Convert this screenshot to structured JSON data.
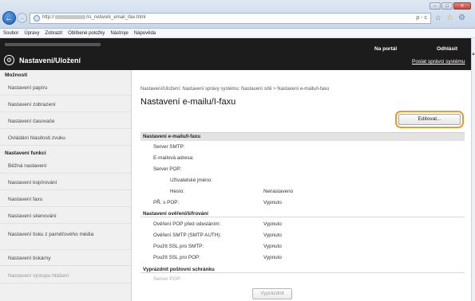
{
  "browser": {
    "url_prefix": "http://",
    "url_suffix": "/rs_network_email_ifax.html",
    "addr_tools": "ρ - c",
    "window_buttons": {
      "min": "–",
      "max": "□",
      "close": "✕"
    }
  },
  "menubar": [
    "Soubor",
    "Úpravy",
    "Zobrazit",
    "Oblíbené položky",
    "Nástroje",
    "Nápověda"
  ],
  "header": {
    "title": "Nastavení/Uložení",
    "portal_link": "Na portál",
    "logout_link": "Odhlásit",
    "mail_link": "Poslat správci systému"
  },
  "sidebar": {
    "section1": "Možnosti",
    "items1": [
      "Nastavení papíru",
      "Nastavení zobrazení",
      "Nastavení časovače",
      "Ovládání hlasitosti zvuku"
    ],
    "section2": "Nastavení funkcí",
    "items2": [
      "Běžná nastavení",
      "Nastavení kopírování",
      "Nastavení faxu",
      "Nastavení skenování",
      "Nastavení tisku z paměťového média",
      "Nastavení tiskárny",
      "Nastavení výstupu hlášení"
    ]
  },
  "main": {
    "breadcrumb": "Nastavení/Uložení: Nastavení správy systému: Nastavení sítě > Nastavení e-mailu/I-faxu",
    "title": "Nastavení e-mailu/I-faxu",
    "edit_button": "Editovat...",
    "section_title": "Nastavení e-mailu/I-faxu",
    "rows": [
      {
        "label": "Server SMTP:",
        "value": ""
      },
      {
        "label": "E-mailová adresa:",
        "value": ""
      },
      {
        "label": "Server POP:",
        "value": ""
      },
      {
        "label": "Uživatelské jméno:",
        "value": ""
      },
      {
        "label": "Heslo:",
        "value": "Nenastaveno"
      },
      {
        "label": "PŘ. s POP:",
        "value": "Vypnuto"
      }
    ],
    "auth_heading": "Nastavení ověření/šifrování",
    "auth_rows": [
      {
        "label": "Ověření POP před odesláním:",
        "value": "Vypnuto"
      },
      {
        "label": "Ověření SMTP (SMTP AUTH):",
        "value": "Vypnuto"
      },
      {
        "label": "Použít SSL pro SMTP:",
        "value": "Vypnuto"
      },
      {
        "label": "Použít SSL pro POP:",
        "value": "Vypnuto"
      }
    ],
    "empty_heading": "Vyprázdnit poštovní schránku",
    "empty_row_label": "Server POP:",
    "empty_button": "Vyprázdnit"
  }
}
